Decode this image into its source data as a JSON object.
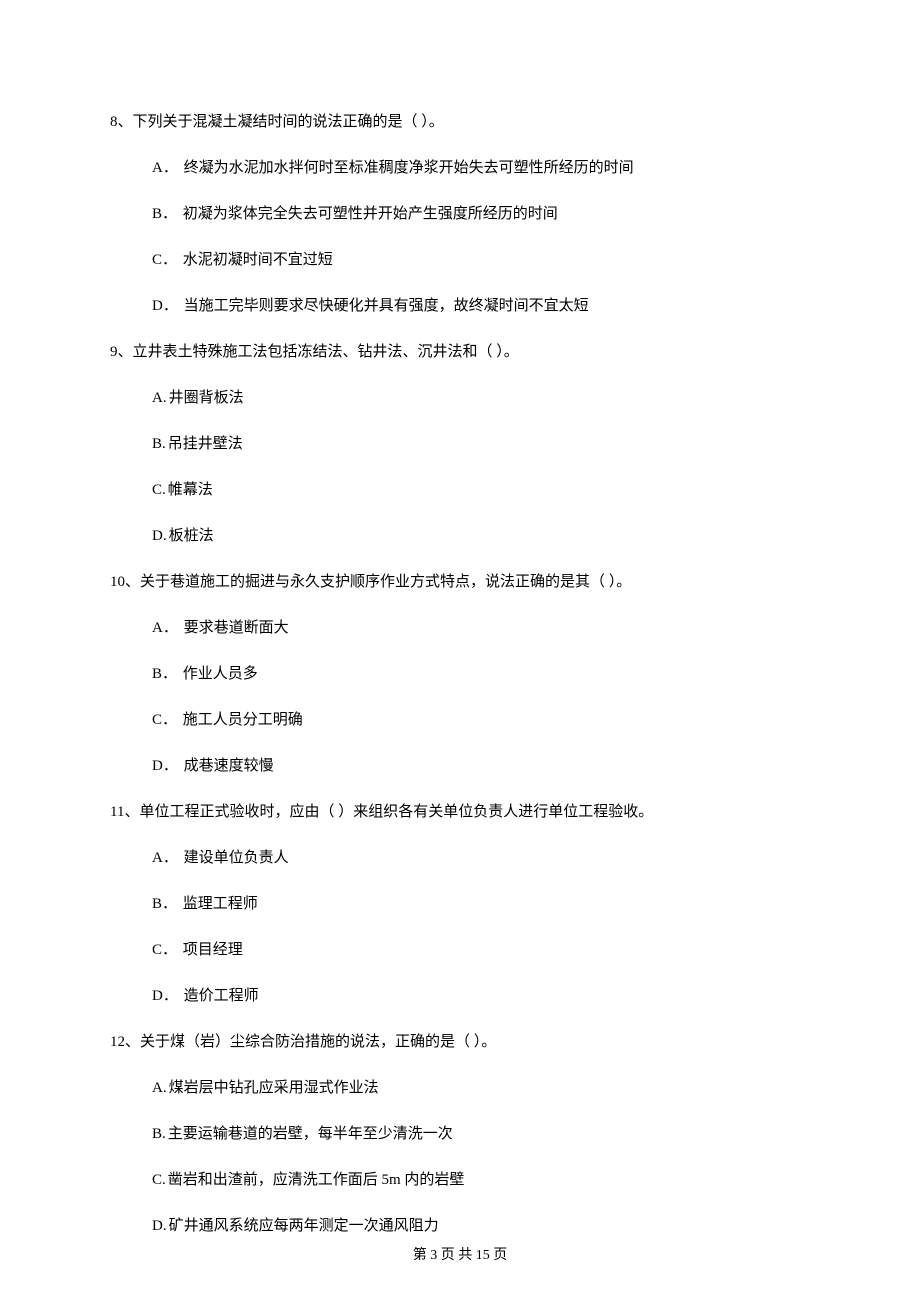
{
  "questions": [
    {
      "number": "8、",
      "stem": "下列关于混凝土凝结时间的说法正确的是（    ）。",
      "options": [
        {
          "label": "A．",
          "text": "终凝为水泥加水拌何时至标准稠度净浆开始失去可塑性所经历的时间"
        },
        {
          "label": "B．",
          "text": "初凝为浆体完全失去可塑性并开始产生强度所经历的时间"
        },
        {
          "label": "C．",
          "text": "水泥初凝时间不宜过短"
        },
        {
          "label": "D．",
          "text": "当施工完毕则要求尽快硬化并具有强度，故终凝时间不宜太短"
        }
      ]
    },
    {
      "number": "9、",
      "stem": "立井表土特殊施工法包括冻结法、钻井法、沉井法和（    ）。",
      "options": [
        {
          "label": "A.",
          "text": "井圈背板法"
        },
        {
          "label": "B.",
          "text": "吊挂井壁法"
        },
        {
          "label": "C.",
          "text": "帷幕法"
        },
        {
          "label": "D.",
          "text": "板桩法"
        }
      ]
    },
    {
      "number": "10、",
      "stem": "关于巷道施工的掘进与永久支护顺序作业方式特点，说法正确的是其（    ）。",
      "options": [
        {
          "label": "A．",
          "text": "要求巷道断面大"
        },
        {
          "label": "B．",
          "text": "作业人员多"
        },
        {
          "label": "C．",
          "text": "施工人员分工明确"
        },
        {
          "label": "D．",
          "text": "成巷速度较慢"
        }
      ]
    },
    {
      "number": "11、",
      "stem": "单位工程正式验收时，应由（    ）来组织各有关单位负责人进行单位工程验收。",
      "options": [
        {
          "label": "A．",
          "text": "建设单位负责人"
        },
        {
          "label": "B．",
          "text": "监理工程师"
        },
        {
          "label": "C．",
          "text": "项目经理"
        },
        {
          "label": "D．",
          "text": "造价工程师"
        }
      ]
    },
    {
      "number": "12、",
      "stem": "关于煤（岩）尘综合防治措施的说法，正确的是（    ）。",
      "options": [
        {
          "label": "A.",
          "text": "煤岩层中钻孔应采用湿式作业法"
        },
        {
          "label": "B.",
          "text": "主要运输巷道的岩壁，每半年至少清洗一次"
        },
        {
          "label": "C.",
          "text": "凿岩和出渣前，应清洗工作面后 5m 内的岩壁"
        },
        {
          "label": "D.",
          "text": "矿井通风系统应每两年测定一次通风阻力"
        }
      ]
    }
  ],
  "footer": "第 3 页 共 15 页"
}
